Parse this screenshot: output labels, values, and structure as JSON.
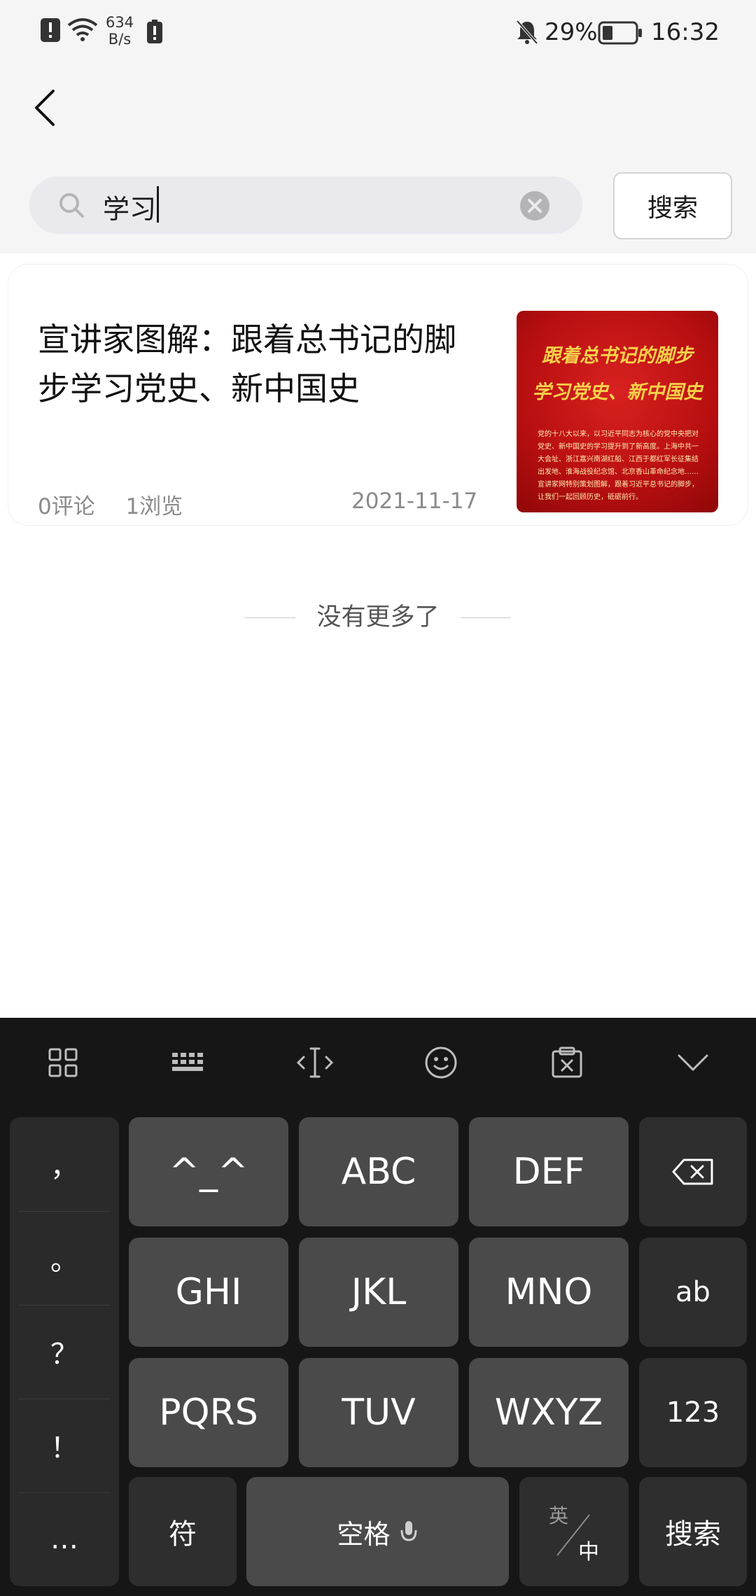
{
  "status_bar": {
    "net_speed_value": "634",
    "net_speed_unit": "B/s",
    "battery": "29%",
    "time": "16:32"
  },
  "search": {
    "query": "学习",
    "button_label": "搜索"
  },
  "result": {
    "title": "宣讲家图解：跟着总书记的脚步学习党史、新中国史",
    "comments": "0评论",
    "views": "1浏览",
    "date": "2021-11-17",
    "thumbnail": {
      "line1": "跟着总书记的脚步",
      "line2": "学习党史、新中国史",
      "body": "党的十八大以来，以习近平同志为核心的党中央把对党史、新中国史的学习提升到了新高度。上海中共一大会址、浙江嘉兴南湖红船、江西于都红军长征集结出发地、淮海战役纪念馆、北京香山革命纪念地……宣讲家网特别策划图解，跟着习近平总书记的脚步，让我们一起回顾历史，砥砺前行。"
    }
  },
  "no_more": "没有更多了",
  "keyboard": {
    "punct": [
      "，",
      "。",
      "？",
      "！",
      "…"
    ],
    "row1": [
      "^_^",
      "ABC",
      "DEF"
    ],
    "row2": [
      "GHI",
      "JKL",
      "MNO"
    ],
    "row2_side": "ab",
    "row3": [
      "PQRS",
      "TUV",
      "WXYZ"
    ],
    "row3_side": "123",
    "symbols": "符",
    "space": "空格",
    "lang_top": "英",
    "lang_bottom": "中",
    "enter": "搜索"
  },
  "colors": {
    "accent_red": "#c41414",
    "keyboard_bg": "#161616",
    "key_bg": "#4a4a4a"
  }
}
